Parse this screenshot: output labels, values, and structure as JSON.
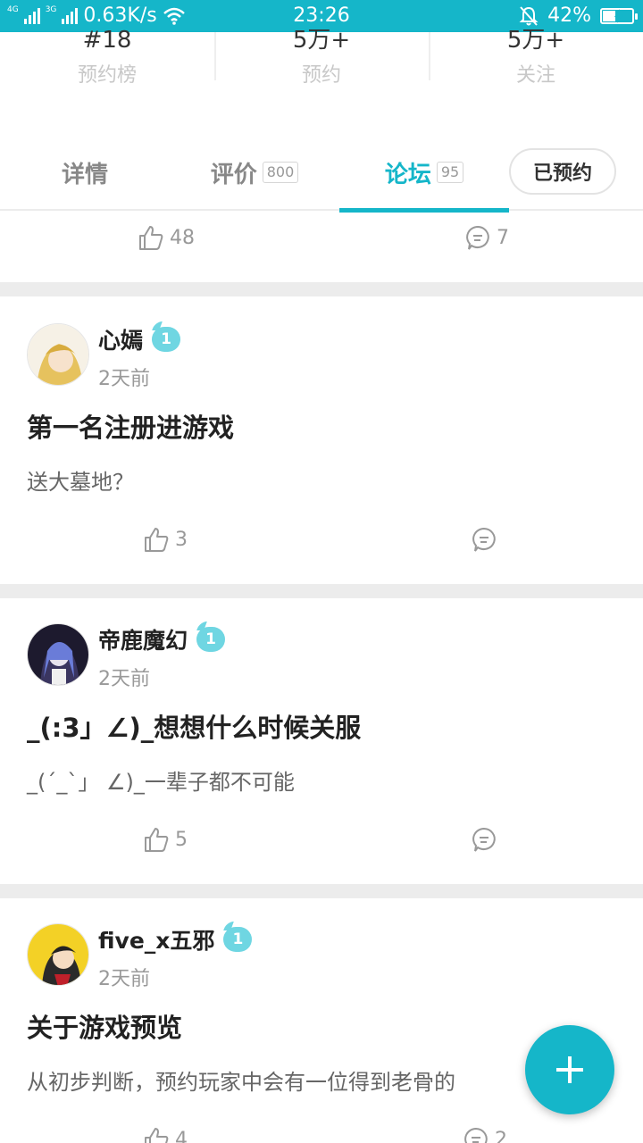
{
  "status_bar": {
    "net_left": "4G",
    "net_right": "3G",
    "speed": "0.63K/s",
    "time": "23:26",
    "battery": "42%",
    "battery_level": 0.42
  },
  "stats": [
    {
      "value": "#18",
      "label": "预约榜"
    },
    {
      "value": "5万+",
      "label": "预约"
    },
    {
      "value": "5万+",
      "label": "关注"
    }
  ],
  "tabs": [
    {
      "label": "详情",
      "badge": ""
    },
    {
      "label": "评价",
      "badge": "800"
    },
    {
      "label": "论坛",
      "badge": "95"
    }
  ],
  "reserve_button": "已预约",
  "top_actions": {
    "likes": "48",
    "comments": "7"
  },
  "posts": [
    {
      "user": "心嫣",
      "level": "1",
      "time": "2天前",
      "title": "第一名注册进游戏",
      "body": "送大墓地？",
      "likes": "3",
      "comments": ""
    },
    {
      "user": "帝鹿魔幻",
      "level": "1",
      "time": "2天前",
      "title": "_(:3」∠)_想想什么时候关服",
      "body": "_(´_`」 ∠)_一辈子都不可能",
      "likes": "5",
      "comments": ""
    },
    {
      "user": "five_x五邪",
      "level": "1",
      "time": "2天前",
      "title": "关于游戏预览",
      "body": "从初步判断，预约玩家中会有一位得到老骨的",
      "likes": "4",
      "comments": "2"
    }
  ],
  "fab_icon": "plus-icon",
  "colors": {
    "accent": "#15b6c9",
    "level_badge": "#6fd6e2",
    "divider": "#ececec"
  }
}
